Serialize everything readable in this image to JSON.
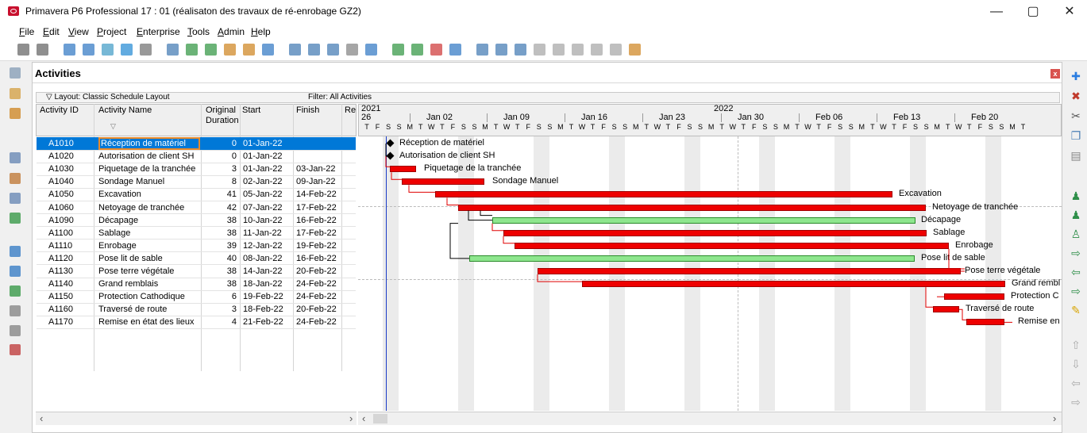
{
  "window": {
    "title": "Primavera P6 Professional 17 : 01 (réalisaton des travaux de ré-enrobage GZ2)",
    "minimize": "—",
    "restore": "▢",
    "close": "✕"
  },
  "menu": [
    "File",
    "Edit",
    "View",
    "Project",
    "Enterprise",
    "Tools",
    "Admin",
    "Help"
  ],
  "panel": {
    "title": "Activities",
    "layout": "▽ Layout: Classic Schedule Layout",
    "filter": "Filter: All Activities",
    "close": "x"
  },
  "columns": {
    "id": "Activity ID",
    "name": "Activity Name",
    "duration_1": "Original",
    "duration_2": "Duration",
    "start": "Start",
    "finish": "Finish",
    "remaining": "Re"
  },
  "activities": [
    {
      "id": "A1010",
      "name": "Réception de matériel",
      "dur": "0",
      "start": "01-Jan-22",
      "finish": ""
    },
    {
      "id": "A1020",
      "name": "Autorisation de client SH",
      "dur": "0",
      "start": "01-Jan-22",
      "finish": ""
    },
    {
      "id": "A1030",
      "name": "Piquetage de la tranchée",
      "dur": "3",
      "start": "01-Jan-22",
      "finish": "03-Jan-22"
    },
    {
      "id": "A1040",
      "name": "Sondage Manuel",
      "dur": "8",
      "start": "02-Jan-22",
      "finish": "09-Jan-22"
    },
    {
      "id": "A1050",
      "name": "Excavation",
      "dur": "41",
      "start": "05-Jan-22",
      "finish": "14-Feb-22"
    },
    {
      "id": "A1060",
      "name": "Netoyage de tranchée",
      "dur": "42",
      "start": "07-Jan-22",
      "finish": "17-Feb-22"
    },
    {
      "id": "A1090",
      "name": "Décapage",
      "dur": "38",
      "start": "10-Jan-22",
      "finish": "16-Feb-22"
    },
    {
      "id": "A1100",
      "name": "Sablage",
      "dur": "38",
      "start": "11-Jan-22",
      "finish": "17-Feb-22"
    },
    {
      "id": "A1110",
      "name": "Enrobage",
      "dur": "39",
      "start": "12-Jan-22",
      "finish": "19-Feb-22"
    },
    {
      "id": "A1120",
      "name": "Pose lit de sable",
      "dur": "40",
      "start": "08-Jan-22",
      "finish": "16-Feb-22"
    },
    {
      "id": "A1130",
      "name": "Pose terre végétale",
      "dur": "38",
      "start": "14-Jan-22",
      "finish": "20-Feb-22"
    },
    {
      "id": "A1140",
      "name": "Grand remblais",
      "dur": "38",
      "start": "18-Jan-22",
      "finish": "24-Feb-22"
    },
    {
      "id": "A1150",
      "name": "Protection Cathodique",
      "dur": "6",
      "start": "19-Feb-22",
      "finish": "24-Feb-22"
    },
    {
      "id": "A1160",
      "name": "Traversé de route",
      "dur": "3",
      "start": "18-Feb-22",
      "finish": "20-Feb-22"
    },
    {
      "id": "A1170",
      "name": "Remise en état des lieux",
      "dur": "4",
      "start": "21-Feb-22",
      "finish": "24-Feb-22"
    }
  ],
  "gantt": {
    "year_left": "2021",
    "year_right": "2022",
    "day_left": "26",
    "weeks": [
      "Jan 02",
      "Jan 09",
      "Jan 16",
      "Jan 23",
      "Jan 30",
      "Feb 06",
      "Feb 13",
      "Feb 20"
    ],
    "day_letters": "TFSSMTWTFSSMTWTFSSMTWTFSSMTWTFSSMTWTFSSMTWTFSSMTWTFSSMTWTFSSMT",
    "bar_labels": [
      "Réception de matériel",
      "Autorisation de client SH",
      "Piquetage de la tranchée",
      "Sondage Manuel",
      "Excavation",
      "Netoyage de tranchée",
      "Décapage",
      "Sablage",
      "Enrobage",
      "Pose lit de sable",
      "Pose terre végétale",
      "Grand rembl",
      "Protection C",
      "Traversé de route",
      "Remise en é"
    ]
  },
  "colors": {
    "critical_bar": "#ee0000",
    "normal_bar": "#8ee68e",
    "selection": "#0078d7",
    "data_date_line": "#1a3cc8"
  }
}
